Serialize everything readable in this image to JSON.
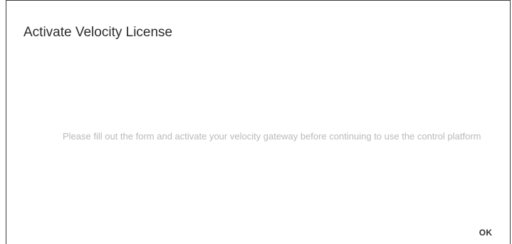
{
  "dialog": {
    "title": "Activate Velocity License",
    "message": "Please fill out the form and activate your velocity gateway before continuing to use the control platform",
    "ok_label": "OK"
  },
  "colors": {
    "border": "#3a3a3a",
    "title_text": "#2b2b2b",
    "message_text": "#b9b9b9",
    "button_text": "#333333",
    "background": "#ffffff"
  }
}
